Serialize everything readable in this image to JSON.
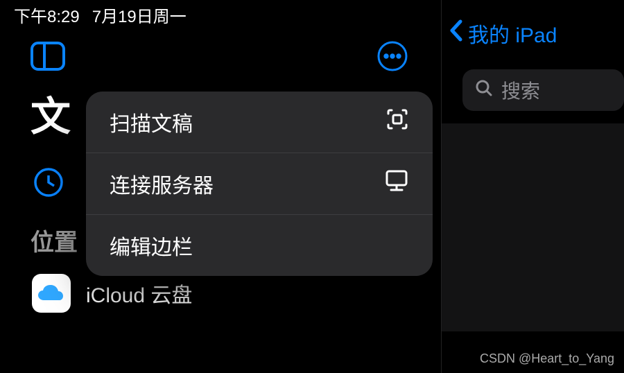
{
  "status": {
    "time": "下午8:29",
    "date": "7月19日周一"
  },
  "sidebar": {
    "title_partial": "文",
    "section_label": "位置",
    "items": [
      {
        "label": "iCloud 云盘"
      }
    ]
  },
  "popover": {
    "items": [
      {
        "label": "扫描文稿",
        "icon": "scan"
      },
      {
        "label": "连接服务器",
        "icon": "server"
      },
      {
        "label": "编辑边栏",
        "icon": ""
      }
    ]
  },
  "right": {
    "back_label": "我的 iPad",
    "search_placeholder": "搜索"
  },
  "watermark": "CSDN @Heart_to_Yang"
}
